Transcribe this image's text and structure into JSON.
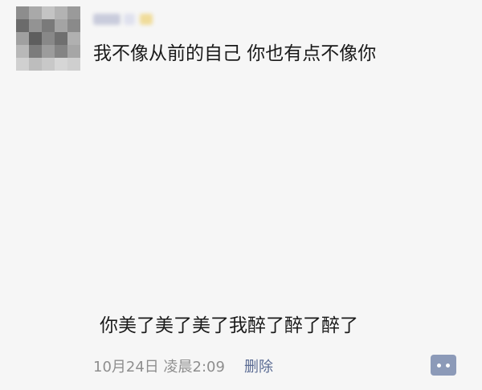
{
  "moment": {
    "text": "我不像从前的自己 你也有点不像你",
    "caption": "你美了美了美了我醉了醉了醉了",
    "timestamp": "10月24日 凌晨2:09",
    "delete_label": "删除"
  },
  "icons": {
    "comment": "comment-bubble-icon"
  }
}
